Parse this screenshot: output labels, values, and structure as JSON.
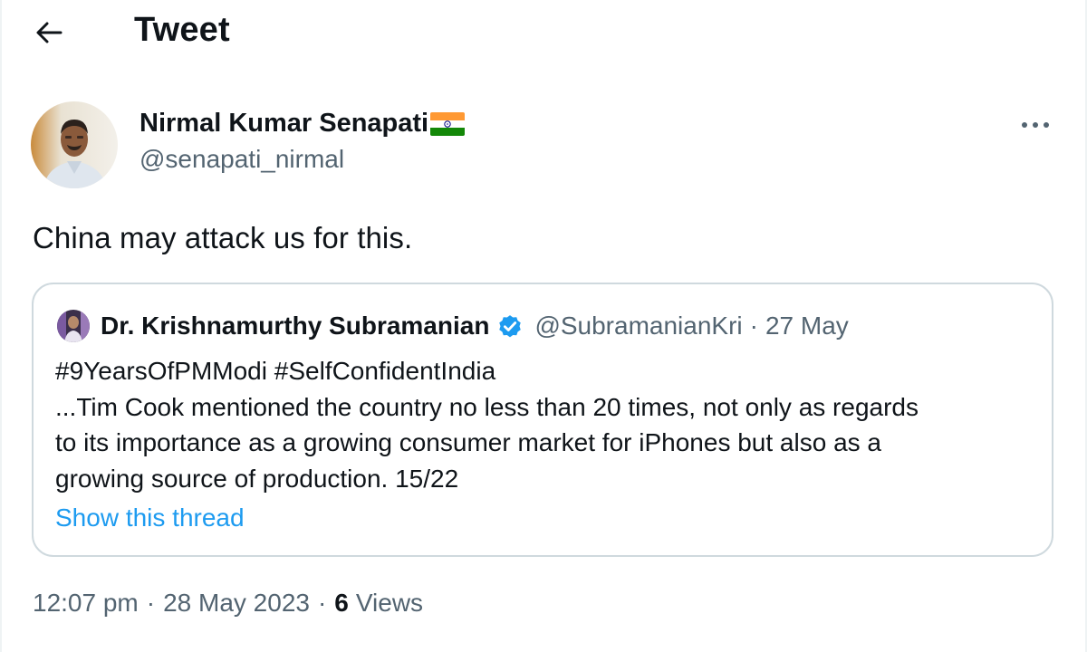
{
  "header": {
    "title": "Tweet",
    "back_icon": "arrow-left-icon"
  },
  "author": {
    "name": "Nirmal Kumar Senapati",
    "flag_icon": "india-flag-icon",
    "handle": "@senapati_nirmal",
    "more_icon": "more-horizontal-icon"
  },
  "tweet": {
    "text": "China may attack us for this."
  },
  "quote": {
    "name": "Dr. Krishnamurthy Subramanian",
    "verified_icon": "verified-badge-icon",
    "handle": "@SubramanianKri",
    "separator": "·",
    "date": "27 May",
    "lines": [
      "#9YearsOfPMModi #SelfConfidentIndia",
      "...Tim Cook mentioned the country no less than 20 times, not only as regards",
      "to its importance as a growing consumer market for iPhones but also as a",
      "growing source of production. 15/22"
    ],
    "show_thread": "Show this thread"
  },
  "meta": {
    "time": "12:07 pm",
    "separator": "·",
    "date": "28 May 2023",
    "views_count": "6",
    "views_label": "Views"
  },
  "colors": {
    "text": "#0f1419",
    "secondary": "#536471",
    "link": "#1d9bf0",
    "border": "#cfd9de"
  }
}
